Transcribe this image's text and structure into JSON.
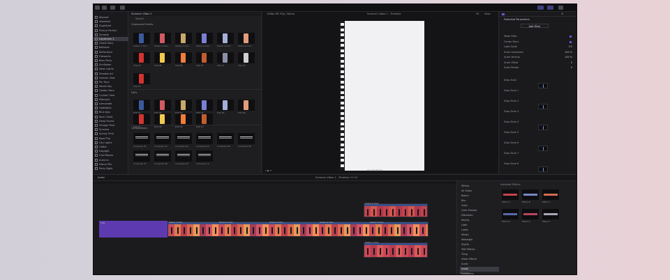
{
  "colors": {
    "accent": "#6b56d6",
    "clip_warm": "#c04f58",
    "clip_cool": "#3a4f86"
  },
  "top_icons": [
    "library-icon",
    "media-icon",
    "clock-icon",
    "music-icon",
    "titles-icon"
  ],
  "libraries": [
    "Wyanet",
    "Sweetest",
    "Sugarfoot",
    "Picture Perfect",
    "Sunsets",
    "Daydream 2",
    "Ghost Story",
    "Balloons",
    "Reflections",
    "Fireworks",
    "Bear Party",
    "Sunflower",
    "Neon Lights",
    "Shadow Art",
    "Horizon View",
    "Pin Tuna",
    "Velvet Sky",
    "Golden Hour",
    "Crystal Clear",
    "Midnight",
    "Lemonade",
    "Highlights",
    "Blue Jays",
    "Rock Climb",
    "Deep Forest",
    "Vintage Pack",
    "Summer",
    "Spring Time",
    "Road Trip",
    "City Lights",
    "Glitter",
    "Daylight",
    "Cool Waves",
    "Autumn",
    "Dance Mix",
    "Party Night"
  ],
  "library_selected_index": 5,
  "browser": {
    "title": "Summer Vibes 1",
    "search_placeholder": "Search",
    "sections": [
      "Ungrouped Events",
      "Edits",
      "Compositions"
    ],
    "row1_labels": [
      "Scene 1.mov",
      "Scene 2.mov",
      "Scene 3.mov",
      "Scene 4.mov",
      "Scene 5.mov",
      "Scene 6.mov"
    ],
    "row2_labels": [
      "Clip 07",
      "Clip 08",
      "Clip 09",
      "Clip 10",
      "Clip 11",
      "Clip 12"
    ],
    "row3_labels": [
      "Clip 13"
    ],
    "row4_labels": [
      "Edit 01",
      "Edit 02",
      "Edit 03",
      "Edit 04",
      "Edit 05",
      "Edit 06"
    ],
    "row5_labels": [
      "Edit 07",
      "Edit 08",
      "Edit 09",
      "Edit 10"
    ],
    "row6_labels": [
      "Compose 01",
      "Compose 02",
      "Compose 03",
      "Compose 04",
      "Compose 05",
      "Compose 06"
    ],
    "row7_labels": [
      "Compose 07",
      "Compose 08",
      "Compose 09",
      "Compose 10"
    ]
  },
  "viewer": {
    "left_title": "1080p HD 30p, Stereo",
    "center_title": "Summer Vibes 1 - Timeline",
    "right_zoom": "Fit",
    "right_view": "View",
    "timecode": "00:00:00:00"
  },
  "inspector": {
    "title": "Published Parameters",
    "button": "Add Filter",
    "rows": [
      {
        "label": "Mode Filter",
        "value": ""
      },
      {
        "label": "Center Point",
        "value": ""
      },
      {
        "label": "Light Scale",
        "value": "0.5"
      },
      {
        "label": "Scale Horizontal",
        "value": "100 %"
      },
      {
        "label": "Scale Vertical",
        "value": "100 %"
      },
      {
        "label": "Scale Offset",
        "value": "0"
      },
      {
        "label": "Scale Rotate",
        "value": "0"
      }
    ],
    "groups": [
      "Drop Zone",
      "Drop Zone 1",
      "Drop Zone 2",
      "Drop Zone 3",
      "Drop Zone 4",
      "Drop Zone 5",
      "Drop Zone 6",
      "Drop Zone 7",
      "Drop Zone 8"
    ]
  },
  "timeline_bar": {
    "index": "Index",
    "title": "Summer Vibes 1 - Timeline",
    "duration": "20:00"
  },
  "clips": {
    "purple": "Title",
    "main": [
      "Scene 1.mov",
      "Scene 2.mov",
      "Scene 3.mov",
      "Scene 4.mov",
      "Scene 5.mov"
    ],
    "upper": "Scene 6.mov",
    "lower": "Scene 7.mov"
  },
  "effects": {
    "header": "Effects",
    "installed": "Installed Effects",
    "items": [
      "All Video",
      "Basics",
      "Blur",
      "Color",
      "Color Presets",
      "Distortion",
      "Keying",
      "Light",
      "Looks",
      "Masks",
      "Nostalgia",
      "Stylize",
      "Text Effects",
      "Tiling",
      "Video Effects",
      "Audio",
      "Install",
      "Favourites"
    ],
    "selected_index": 16,
    "thumbs": [
      "Effect A",
      "Effect B",
      "Effect C",
      "Effect D",
      "Effect E",
      "Effect F"
    ],
    "footer": "6 items"
  }
}
